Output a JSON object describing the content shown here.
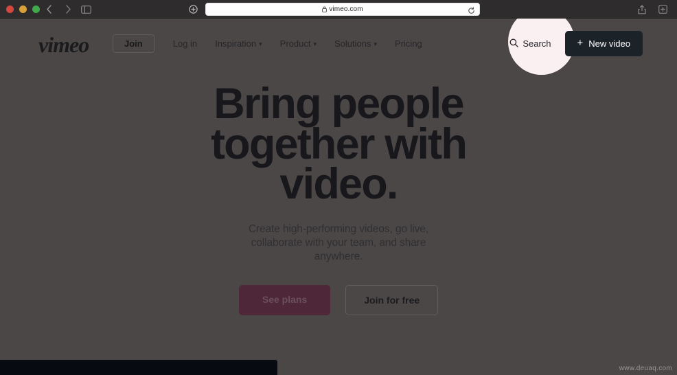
{
  "browser": {
    "traffic_lights": [
      "close",
      "minimize",
      "zoom"
    ],
    "back_label": "Back",
    "forward_label": "Forward",
    "sidebar_label": "Show sidebar",
    "shield_label": "Privacy report",
    "url": "vimeo.com",
    "lock_icon": "lock-icon",
    "reload_label": "Reload",
    "share_label": "Share",
    "newtab_label": "New tab"
  },
  "site": {
    "logo_text": "vimeo",
    "nav_primary": [
      {
        "label": "Join",
        "style": "outline",
        "caret": false
      },
      {
        "label": "Log in",
        "style": "plain",
        "caret": false
      },
      {
        "label": "Inspiration",
        "style": "plain",
        "caret": true
      },
      {
        "label": "Product",
        "style": "plain",
        "caret": true
      },
      {
        "label": "Solutions",
        "style": "plain",
        "caret": true
      },
      {
        "label": "Pricing",
        "style": "plain",
        "caret": false
      }
    ],
    "search_label": "Search",
    "search_icon": "search-icon",
    "new_video_label": "New video",
    "new_video_icon": "plus-icon"
  },
  "hero": {
    "title_line1": "Bring people",
    "title_line2": "together with",
    "title_line3": "video.",
    "subtitle": "Create high-performing videos, go live, collaborate with your team, and share anywhere.",
    "primary_cta": "See plans",
    "secondary_cta": "Join for free"
  },
  "overlay": {
    "spotlight_target": "Search",
    "spotlight_color": "#fbf0f1",
    "dim_color": "#4a4746"
  },
  "watermark": "www.deuaq.com"
}
